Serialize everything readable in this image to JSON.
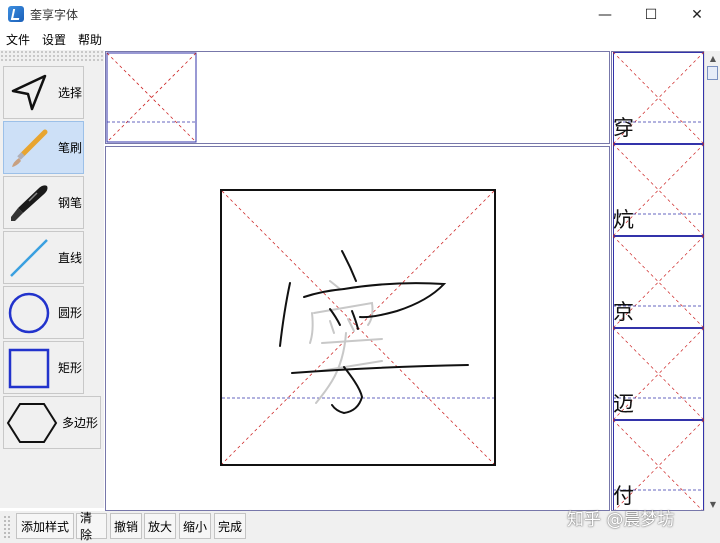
{
  "window": {
    "title": "奎享字体",
    "min_glyph": "—",
    "max_glyph": "☐",
    "close_glyph": "✕"
  },
  "menu": [
    "文件",
    "设置",
    "帮助"
  ],
  "tools": [
    {
      "label": "选择",
      "icon": "cursor-arrow-icon"
    },
    {
      "label": "笔刷",
      "icon": "brush-icon",
      "active": true
    },
    {
      "label": "钢笔",
      "icon": "fountain-pen-icon"
    },
    {
      "label": "直线",
      "icon": "line-icon"
    },
    {
      "label": "圆形",
      "icon": "circle-icon"
    },
    {
      "label": "矩形",
      "icon": "rectangle-icon"
    },
    {
      "label": "多边形",
      "icon": "hexagon-icon"
    }
  ],
  "character_list": [
    "穿",
    "炕",
    "京",
    "迈",
    "付"
  ],
  "bottom_buttons": [
    "添加样式",
    "清除",
    "撤销",
    "放大",
    "缩小",
    "完成"
  ],
  "watermark": "知乎 @晨梦坊",
  "colors": {
    "accent": "#cde0f7",
    "guide_red": "#cc2222",
    "guide_blue": "#3333aa",
    "border": "#7777aa"
  }
}
